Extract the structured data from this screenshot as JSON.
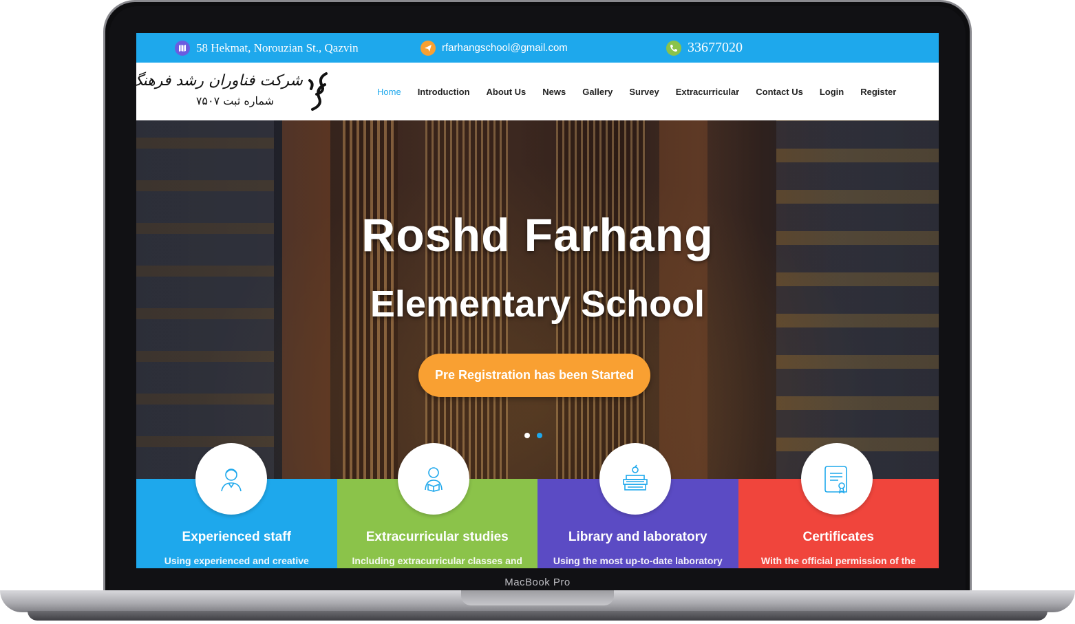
{
  "topbar": {
    "address": "58 Hekmat, Norouzian St., Qazvin",
    "email": "rfarhangschool@gmail.com",
    "phone": "33677020",
    "colors": {
      "bar": "#1ea8ec",
      "address_icon": "#6b5ce0",
      "email_icon": "#f9a032",
      "phone_icon": "#8bc34a"
    }
  },
  "logo": {
    "line1": "شرکت فناوران رشد فرهنگ",
    "line2": "شماره ثبت ۷۵۰۷"
  },
  "nav": {
    "items": [
      "Home",
      "Introduction",
      "About Us",
      "News",
      "Gallery",
      "Survey",
      "Extracurricular",
      "Contact Us",
      "Login",
      "Register"
    ],
    "active_color": "#1ea8ec"
  },
  "hero": {
    "title": "Roshd Farhang",
    "subtitle": "Elementary School",
    "cta": "Pre Registration has been Started",
    "cta_color": "#f9a032",
    "slider_active": 1,
    "slider_count": 2
  },
  "features": [
    {
      "title": "Experienced staff",
      "desc": "Using experienced and creative",
      "color": "#1ea8ec",
      "icon": "teacher-icon"
    },
    {
      "title": "Extracurricular studies",
      "desc": "Including extracurricular classes and",
      "color": "#8bc34a",
      "icon": "student-reading-icon"
    },
    {
      "title": "Library and laboratory",
      "desc": "Using the most up-to-date laboratory",
      "color": "#5b4bc4",
      "icon": "books-icon"
    },
    {
      "title": "Certificates",
      "desc": "With the official permission of the",
      "color": "#f0453c",
      "icon": "certificate-icon"
    }
  ],
  "device": {
    "label": "MacBook Pro"
  }
}
